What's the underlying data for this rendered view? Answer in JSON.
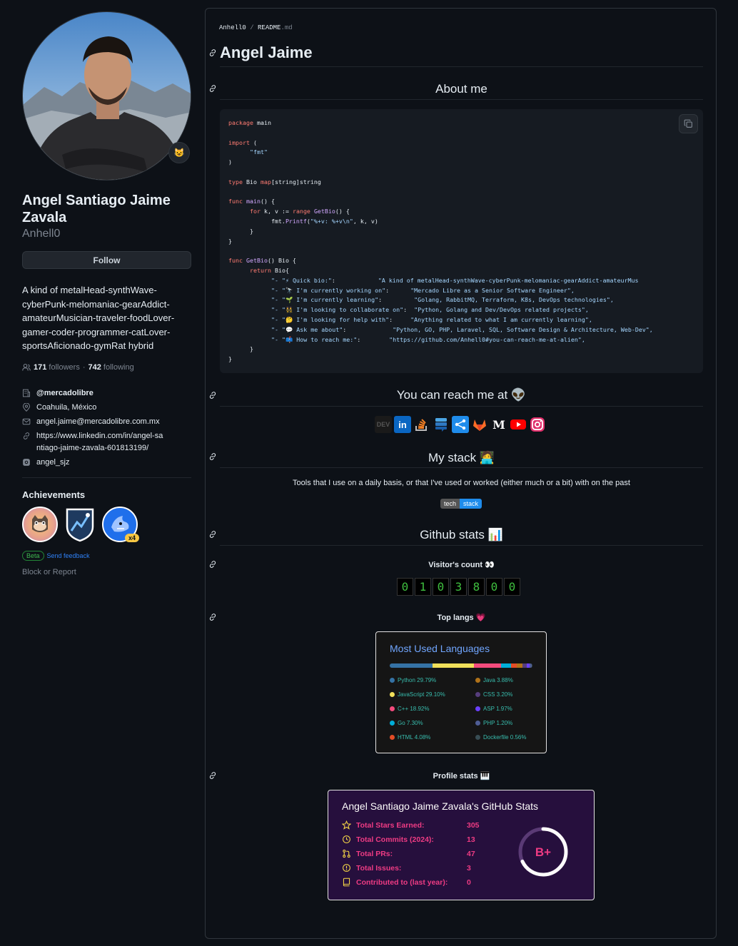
{
  "profile": {
    "fullname": "Angel Santiago Jaime Zavala",
    "username": "Anhell0",
    "follow_label": "Follow",
    "bio": "A kind of metalHead-synthWave-cyberPunk-melomaniac-gearAddict-amateurMusician-traveler-foodLover-gamer-coder-programmer-catLover-sportsAficionado-gymRat hybrid",
    "followers_count": "171",
    "followers_label": "followers",
    "following_count": "742",
    "following_label": "following",
    "org": "@mercadolibre",
    "location": "Coahuila, México",
    "email": "angel.jaime@mercadolibre.com.mx",
    "website": "https://www.linkedin.com/in/angel-santiago-jaime-zavala-601813199/",
    "social": "angel_sjz",
    "achievements_title": "Achievements",
    "achievement_multiplier": "x4",
    "beta_label": "Beta",
    "feedback_label": "Send feedback",
    "block_label": "Block or Report"
  },
  "readme": {
    "crumb_user": "Anhell0",
    "crumb_sep": "/",
    "crumb_file": "README",
    "crumb_ext": ".md",
    "title": "Angel Jaime",
    "about_heading": "About me",
    "reach_heading": "You can reach me at 👽",
    "stack_heading": "My stack 🧑‍💻",
    "stack_text": "Tools that I use on a daily basis, or that I've used or worked (either much or a bit) with on the past",
    "techstack_left": "tech",
    "techstack_right": "stack",
    "stats_heading": "Github stats 📊",
    "visitors_heading": "Visitor's count 👀",
    "visitor_digits": [
      "0",
      "1",
      "0",
      "3",
      "8",
      "0",
      "0"
    ],
    "toplangs_heading": "Top langs 💗",
    "profile_stats_heading": "Profile stats 🎹"
  },
  "code": {
    "bio_keys": [
      "\"⚡ Quick bio:\"",
      "\"🔭 I'm currently working on\"",
      "\"🌱 I'm currently learning\"",
      "\"👯 I'm looking to collaborate on\"",
      "\"🤔 I'm looking for help with\"",
      "\"💬 Ask me about\"",
      "\"📫 How to reach me:\""
    ],
    "bio_values": [
      "\"A kind of metalHead-synthWave-cyberPunk-melomaniac-gearAddict-amateurMus",
      "\"Mercado Libre as a Senior Software Engineer\",",
      "\"Golang, RabbitMQ, Terraform, K8s, DevOps technologies\",",
      "\"Python, Golang and Dev/DevOps related projects\",",
      "\"Anything related to what I am currently learning\",",
      "\"Python, GO, PHP, Laravel, SQL, Software Design & Architecture, Web-Dev\",",
      "\"https://github.com/Anhell0#you-can-reach-me-at-alien\","
    ]
  },
  "langs": {
    "title": "Most Used Languages",
    "items": [
      {
        "name": "Python",
        "pct": "29.79%",
        "color": "#3572A5"
      },
      {
        "name": "JavaScript",
        "pct": "29.10%",
        "color": "#f1e05a"
      },
      {
        "name": "C++",
        "pct": "18.92%",
        "color": "#f34b7d"
      },
      {
        "name": "Go",
        "pct": "7.30%",
        "color": "#00ADD8"
      },
      {
        "name": "HTML",
        "pct": "4.08%",
        "color": "#e34c26"
      },
      {
        "name": "Java",
        "pct": "3.88%",
        "color": "#b07219"
      },
      {
        "name": "CSS",
        "pct": "3.20%",
        "color": "#563d7c"
      },
      {
        "name": "ASP",
        "pct": "1.97%",
        "color": "#6a40fd"
      },
      {
        "name": "PHP",
        "pct": "1.20%",
        "color": "#4F5D95"
      },
      {
        "name": "Dockerfile",
        "pct": "0.56%",
        "color": "#384d54"
      }
    ]
  },
  "stats": {
    "title": "Angel Santiago Jaime Zavala's GitHub Stats",
    "rows": [
      {
        "label": "Total Stars Earned:",
        "value": "305",
        "icon": "star-icon"
      },
      {
        "label": "Total Commits (2024):",
        "value": "13",
        "icon": "history-icon"
      },
      {
        "label": "Total PRs:",
        "value": "47",
        "icon": "pull-request-icon"
      },
      {
        "label": "Total Issues:",
        "value": "3",
        "icon": "issue-icon"
      },
      {
        "label": "Contributed to (last year):",
        "value": "0",
        "icon": "repo-icon"
      }
    ],
    "rank": "B+",
    "rank_progress": 0.68
  },
  "colors": {
    "accent": "#2f81f7",
    "stats_bg": "#260f3d",
    "stats_text": "#ee3b83",
    "lang_title": "#70a5fd"
  }
}
